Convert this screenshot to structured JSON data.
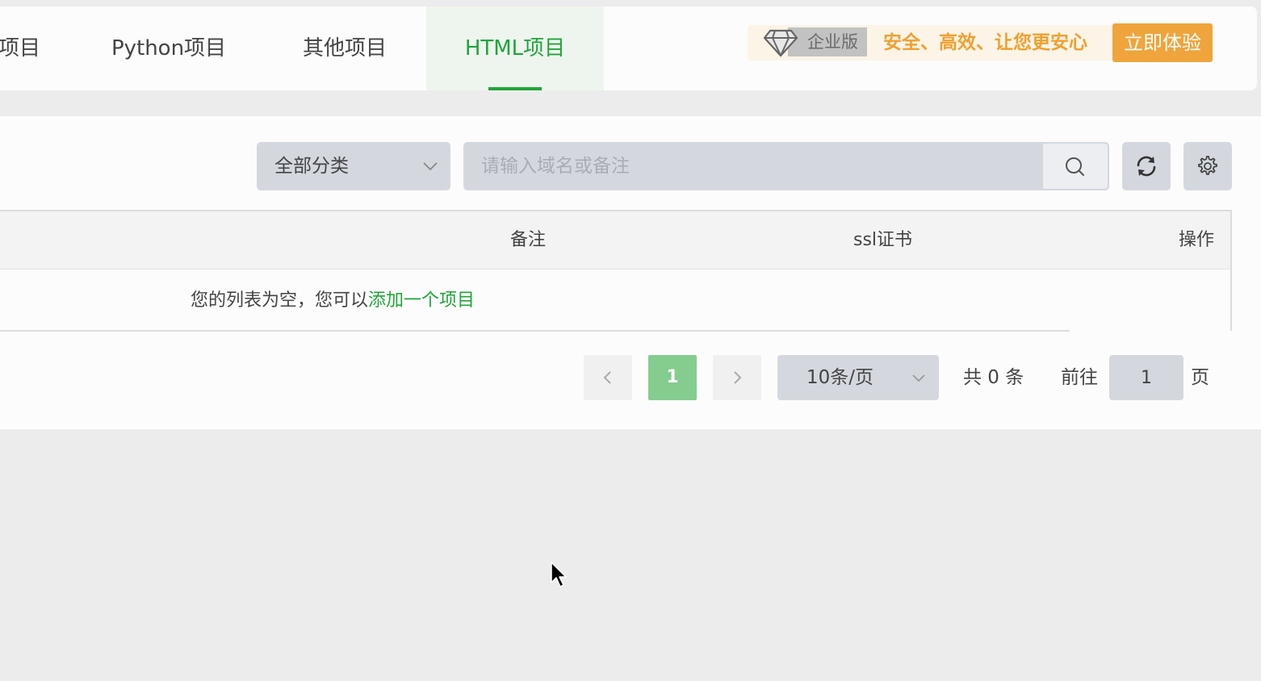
{
  "tabs": [
    {
      "label": "项目",
      "active": false
    },
    {
      "label": "Python项目",
      "active": false
    },
    {
      "label": "其他项目",
      "active": false
    },
    {
      "label": "HTML项目",
      "active": true
    }
  ],
  "promo": {
    "edition": "企业版",
    "slogan": "安全、高效、让您更安心",
    "button": "立即体验"
  },
  "toolbar": {
    "category_select": "全部分类",
    "search_placeholder": "请输入域名或备注"
  },
  "table": {
    "columns": [
      "备注",
      "ssl证书",
      "操作"
    ],
    "empty_text": "您的列表为空，您可以",
    "empty_link": "添加一个项目"
  },
  "pagination": {
    "current_page": "1",
    "page_size": "10条/页",
    "total": "共 0 条",
    "goto_prefix": "前往",
    "goto_value": "1",
    "goto_suffix": "页"
  },
  "colors": {
    "accent": "#20a53a",
    "promo": "#f0a43c"
  }
}
